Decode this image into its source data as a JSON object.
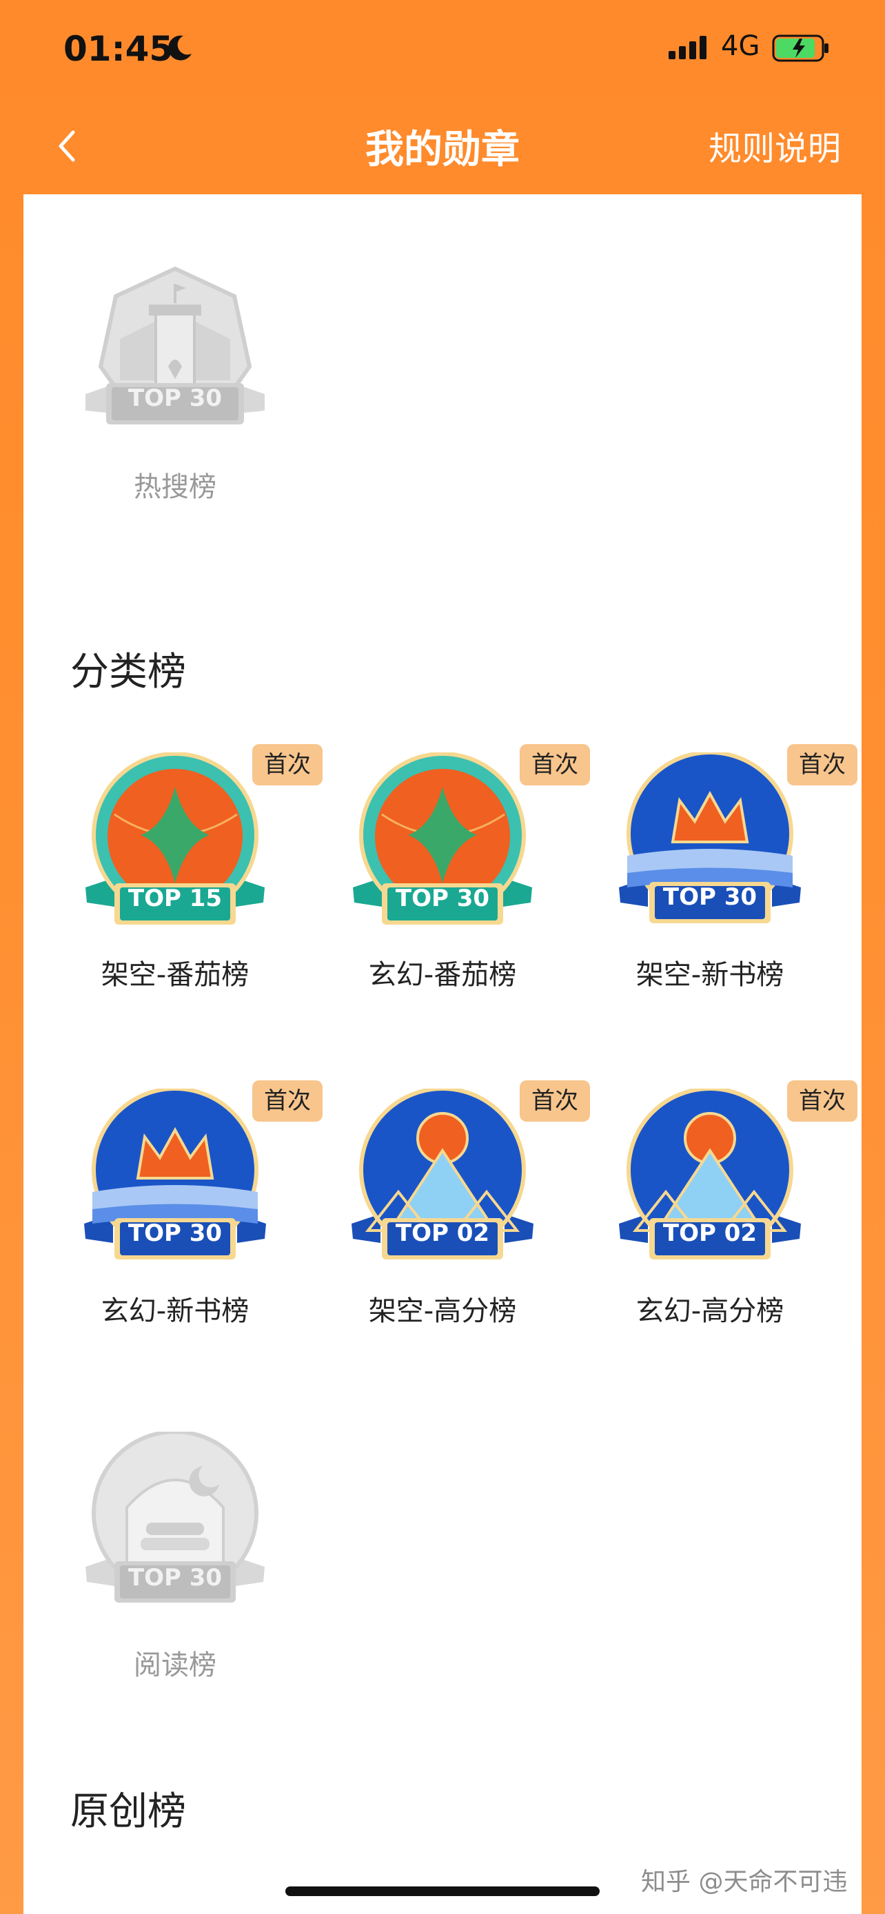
{
  "status_bar": {
    "time": "01:45",
    "network": "4G"
  },
  "nav": {
    "title": "我的勋章",
    "rules_label": "规则说明"
  },
  "sections": {
    "hot": {
      "badges": [
        {
          "label": "热搜榜",
          "rank": "TOP 30"
        }
      ]
    },
    "category": {
      "title": "分类榜",
      "first_tag": "首次",
      "badges": [
        {
          "label": "架空-番茄榜",
          "rank": "TOP 15"
        },
        {
          "label": "玄幻-番茄榜",
          "rank": "TOP 30"
        },
        {
          "label": "架空-新书榜",
          "rank": "TOP 30"
        },
        {
          "label": "玄幻-新书榜",
          "rank": "TOP 30"
        },
        {
          "label": "架空-高分榜",
          "rank": "TOP 02"
        },
        {
          "label": "玄幻-高分榜",
          "rank": "TOP 02"
        }
      ]
    },
    "reading": {
      "badges": [
        {
          "label": "阅读榜",
          "rank": "TOP 30"
        }
      ]
    },
    "original": {
      "title": "原创榜"
    }
  },
  "watermark": "知乎 @天命不可违",
  "colors": {
    "accent": "#ff8a2b",
    "tag": "#f8c58c",
    "badge_blue": "#1a55c8",
    "badge_teal": "#3cc0b0",
    "badge_orange": "#f06020"
  }
}
